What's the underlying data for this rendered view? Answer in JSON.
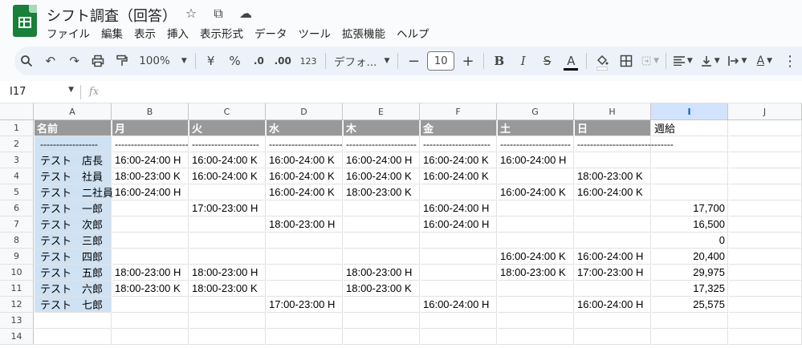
{
  "app": {
    "title": "シフト調査（回答）",
    "title_icons": [
      "☆",
      "⧉",
      "☁"
    ]
  },
  "menu": [
    "ファイル",
    "編集",
    "表示",
    "挿入",
    "表示形式",
    "データ",
    "ツール",
    "拡張機能",
    "ヘルプ"
  ],
  "toolbar": {
    "zoom": "100%",
    "currency": "¥",
    "percent": "%",
    "dec_decrease": ".0",
    "dec_increase": ".00",
    "number_format": "123",
    "font": "デフォ...",
    "font_size": "10",
    "bold": "B",
    "italic": "I",
    "strike": "S",
    "text_color": "A",
    "minus": "−",
    "plus": "+"
  },
  "formula_bar": {
    "name_box": "I17",
    "fx": "fx",
    "formula": ""
  },
  "columns": [
    "A",
    "B",
    "C",
    "D",
    "E",
    "F",
    "G",
    "H",
    "I",
    "J"
  ],
  "selected_column": "I",
  "rows": [
    "1",
    "2",
    "3",
    "4",
    "5",
    "6",
    "7",
    "8",
    "9",
    "10",
    "11",
    "12",
    "13",
    "14"
  ],
  "sheet": {
    "header": [
      "名前",
      "月",
      "火",
      "水",
      "木",
      "金",
      "土",
      "日",
      "週給"
    ],
    "dashes": [
      "------------------",
      "-----------------------",
      "---------------------",
      "-----------------------",
      "----------------------",
      "---------------------",
      "----------------------",
      "------------------------------"
    ],
    "data": [
      [
        "テスト　店長",
        "16:00-24:00 H",
        "16:00-24:00 K",
        "16:00-24:00 K",
        "16:00-24:00 H",
        "16:00-24:00 K",
        "16:00-24:00 H",
        "",
        ""
      ],
      [
        "テスト　社員",
        "18:00-23:00 K",
        "16:00-24:00 K",
        "16:00-24:00 K",
        "16:00-24:00 K",
        "16:00-24:00 K",
        "",
        "18:00-23:00 K",
        ""
      ],
      [
        "テスト　二社員",
        "16:00-24:00 H",
        "",
        "16:00-24:00 K",
        "18:00-23:00 K",
        "",
        "16:00-24:00 K",
        "16:00-24:00 K",
        ""
      ],
      [
        "テスト　一郎",
        "",
        "17:00-23:00 H",
        "",
        "",
        "16:00-24:00 H",
        "",
        "",
        "17,700"
      ],
      [
        "テスト　次郎",
        "",
        "",
        "18:00-23:00 H",
        "",
        "16:00-24:00 H",
        "",
        "",
        "16,500"
      ],
      [
        "テスト　三郎",
        "",
        "",
        "",
        "",
        "",
        "",
        "",
        "0"
      ],
      [
        "テスト　四郎",
        "",
        "",
        "",
        "",
        "",
        "16:00-24:00 K",
        "16:00-24:00 H",
        "20,400"
      ],
      [
        "テスト　五郎",
        "18:00-23:00 H",
        "18:00-23:00 H",
        "",
        "18:00-23:00 H",
        "",
        "18:00-23:00 K",
        "17:00-23:00 H",
        "29,975"
      ],
      [
        "テスト　六郎",
        "18:00-23:00 K",
        "18:00-23:00 K",
        "",
        "18:00-23:00 K",
        "",
        "",
        "",
        "17,325"
      ],
      [
        "テスト　七郎",
        "",
        "",
        "17:00-23:00 H",
        "",
        "16:00-24:00 H",
        "",
        "16:00-24:00 H",
        "25,575"
      ]
    ]
  },
  "colors": {
    "header_bg": "#999999",
    "name_bg": "#cfe2f3",
    "selected_col": "#d3e3fd",
    "logo": "#188038"
  }
}
